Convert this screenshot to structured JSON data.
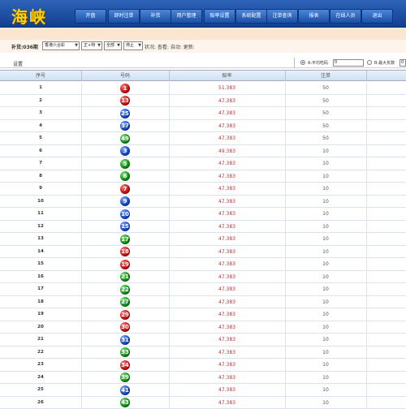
{
  "header": {
    "logo": "海峡",
    "nav": [
      "开盘",
      "即时注单",
      "补货",
      "用户管理",
      "赔率设置",
      "系统配置",
      "注单查询",
      "报表",
      "在线人员",
      "退出"
    ]
  },
  "filters": {
    "label": "补货:036期",
    "selects": [
      "香港六合彩",
      "正+特",
      "全部",
      "停止"
    ],
    "note": "状况: 查看: 自动: 更新:"
  },
  "settings": {
    "title": "设置",
    "option_a": "A:平均吃码",
    "option_a_value": "0",
    "option_b": "B:最大负数",
    "option_b_value": "0"
  },
  "table": {
    "headers": [
      "序号",
      "号码",
      "赔率",
      "注单"
    ],
    "rows": [
      {
        "idx": "1",
        "num": "1",
        "color": "red",
        "odds": "51.383",
        "amt": "50"
      },
      {
        "idx": "2",
        "num": "13",
        "color": "red",
        "odds": "47.383",
        "amt": "50"
      },
      {
        "idx": "3",
        "num": "25",
        "color": "blue",
        "odds": "47.383",
        "amt": "50"
      },
      {
        "idx": "4",
        "num": "37",
        "color": "blue",
        "odds": "47.383",
        "amt": "50"
      },
      {
        "idx": "5",
        "num": "49",
        "color": "green",
        "odds": "47.383",
        "amt": "50"
      },
      {
        "idx": "6",
        "num": "3",
        "color": "blue",
        "odds": "49.383",
        "amt": "10"
      },
      {
        "idx": "7",
        "num": "5",
        "color": "green",
        "odds": "47.383",
        "amt": "10"
      },
      {
        "idx": "8",
        "num": "6",
        "color": "green",
        "odds": "47.383",
        "amt": "10"
      },
      {
        "idx": "9",
        "num": "7",
        "color": "red",
        "odds": "47.383",
        "amt": "10"
      },
      {
        "idx": "10",
        "num": "9",
        "color": "blue",
        "odds": "47.383",
        "amt": "10"
      },
      {
        "idx": "11",
        "num": "10",
        "color": "blue",
        "odds": "47.383",
        "amt": "10"
      },
      {
        "idx": "12",
        "num": "15",
        "color": "blue",
        "odds": "47.383",
        "amt": "10"
      },
      {
        "idx": "13",
        "num": "17",
        "color": "green",
        "odds": "47.383",
        "amt": "10"
      },
      {
        "idx": "14",
        "num": "18",
        "color": "red",
        "odds": "47.383",
        "amt": "10"
      },
      {
        "idx": "15",
        "num": "19",
        "color": "red",
        "odds": "47.383",
        "amt": "10"
      },
      {
        "idx": "16",
        "num": "21",
        "color": "green",
        "odds": "47.383",
        "amt": "10"
      },
      {
        "idx": "17",
        "num": "22",
        "color": "green",
        "odds": "47.383",
        "amt": "10"
      },
      {
        "idx": "18",
        "num": "27",
        "color": "green",
        "odds": "47.383",
        "amt": "10"
      },
      {
        "idx": "19",
        "num": "29",
        "color": "red",
        "odds": "47.383",
        "amt": "10"
      },
      {
        "idx": "20",
        "num": "30",
        "color": "red",
        "odds": "47.383",
        "amt": "10"
      },
      {
        "idx": "21",
        "num": "31",
        "color": "blue",
        "odds": "47.383",
        "amt": "10"
      },
      {
        "idx": "22",
        "num": "33",
        "color": "green",
        "odds": "47.383",
        "amt": "10"
      },
      {
        "idx": "23",
        "num": "34",
        "color": "red",
        "odds": "47.383",
        "amt": "10"
      },
      {
        "idx": "24",
        "num": "39",
        "color": "green",
        "odds": "47.383",
        "amt": "10"
      },
      {
        "idx": "25",
        "num": "41",
        "color": "blue",
        "odds": "47.383",
        "amt": "10"
      },
      {
        "idx": "26",
        "num": "43",
        "color": "green",
        "odds": "47.383",
        "amt": "10"
      }
    ]
  }
}
